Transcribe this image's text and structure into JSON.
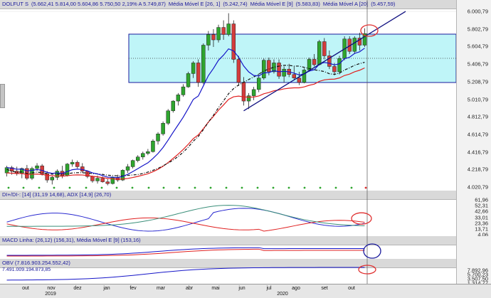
{
  "main_pane": {
    "title_parts": [
      {
        "text": "DOLFUT S",
        "color": "#1a1a9c"
      },
      {
        "text": "(5.662,41  5.814,00  5.604,86  5.750,50  2,19%  A 5.749,87)",
        "color": "#1a1a9c"
      },
      {
        "text": "Média Móvel E [26, 1]",
        "color": "#1a1a9c"
      },
      {
        "text": "(5.242,74)",
        "color": "#1a1a9c"
      },
      {
        "text": "Média Móvel E [9]",
        "color": "#1a1a9c"
      },
      {
        "text": "(5.583,83)",
        "color": "#1a1a9c"
      },
      {
        "text": "Média Móvel A [20]",
        "color": "#1a1a9c"
      },
      {
        "text": "(5.457,59)",
        "color": "#1a1a9c"
      }
    ],
    "y_labels": [
      "6.000,79",
      "5.802,79",
      "5.604,79",
      "5.406,79",
      "5.208,79",
      "5.010,79",
      "4.812,79",
      "4.614,79",
      "4.416,79",
      "4.218,79",
      "4.020,79"
    ],
    "ylim": [
      4020.79,
      6000.79
    ]
  },
  "di_pane": {
    "title": "DI+/DI-: [14] (31,19  14,68), ADX [14,9] (26,70)",
    "y_labels": [
      "61,96",
      "52,31",
      "42,66",
      "33,01",
      "23,36",
      "13,71",
      "4,06"
    ]
  },
  "macd_pane": {
    "title": "MACD Linha: (26,12) (156,31), Média Móvel E [9] (153,16)"
  },
  "obv_pane": {
    "title": "OBV (7.816.903.254.552,42)",
    "left_value": "7.491.009.194.873,85",
    "y_labels": [
      "7.892,96",
      "5.700,23",
      "3.507,50",
      "1.314,77"
    ]
  },
  "x_axis": {
    "months": [
      "out",
      "nov",
      "dez",
      "jan",
      "fev",
      "mar",
      "abr",
      "mai",
      "jun",
      "jul",
      "ago",
      "set",
      "out"
    ],
    "years": [
      "2019",
      "2020"
    ]
  },
  "colors": {
    "bull": "#2ea52e",
    "bear": "#d43c3c",
    "ema9": "#1515c8",
    "ema26": "#e02020",
    "sma20": "#111111",
    "trend": "#101080",
    "channel": "#bff5f8",
    "annotation": "#e03030",
    "di_plus": "#2a2ad0",
    "di_minus": "#e02020",
    "adx": "#3b8f7a"
  },
  "chart_data": {
    "type": "candlestick",
    "title": "DOLFUT S",
    "ylim": [
      4020.79,
      6000.79
    ],
    "ohlc": [
      [
        4180,
        4260,
        4140,
        4240
      ],
      [
        4240,
        4260,
        4160,
        4200
      ],
      [
        4200,
        4250,
        4150,
        4180
      ],
      [
        4180,
        4240,
        4120,
        4230
      ],
      [
        4230,
        4270,
        4100,
        4120
      ],
      [
        4120,
        4250,
        4100,
        4230
      ],
      [
        4230,
        4290,
        4200,
        4260
      ],
      [
        4260,
        4280,
        4150,
        4170
      ],
      [
        4170,
        4200,
        4070,
        4100
      ],
      [
        4100,
        4150,
        4050,
        4130
      ],
      [
        4130,
        4220,
        4100,
        4200
      ],
      [
        4200,
        4260,
        4120,
        4150
      ],
      [
        4150,
        4290,
        4140,
        4280
      ],
      [
        4280,
        4330,
        4250,
        4300
      ],
      [
        4300,
        4320,
        4230,
        4250
      ],
      [
        4250,
        4290,
        4180,
        4200
      ],
      [
        4200,
        4210,
        4120,
        4140
      ],
      [
        4140,
        4150,
        4070,
        4090
      ],
      [
        4090,
        4150,
        4060,
        4120
      ],
      [
        4120,
        4140,
        4070,
        4080
      ],
      [
        4080,
        4110,
        4040,
        4060
      ],
      [
        4060,
        4140,
        4050,
        4130
      ],
      [
        4130,
        4160,
        4080,
        4100
      ],
      [
        4100,
        4220,
        4090,
        4210
      ],
      [
        4210,
        4280,
        4180,
        4250
      ],
      [
        4250,
        4330,
        4230,
        4320
      ],
      [
        4320,
        4380,
        4300,
        4360
      ],
      [
        4360,
        4420,
        4330,
        4400
      ],
      [
        4400,
        4450,
        4380,
        4420
      ],
      [
        4420,
        4560,
        4410,
        4540
      ],
      [
        4540,
        4640,
        4500,
        4620
      ],
      [
        4620,
        4760,
        4600,
        4740
      ],
      [
        4740,
        4900,
        4720,
        4880
      ],
      [
        4880,
        5000,
        4860,
        4990
      ],
      [
        4990,
        5080,
        4940,
        5060
      ],
      [
        5060,
        5180,
        5040,
        5150
      ],
      [
        5150,
        5320,
        5140,
        5300
      ],
      [
        5300,
        5440,
        5250,
        5420
      ],
      [
        5420,
        5460,
        5150,
        5200
      ],
      [
        5200,
        5640,
        5180,
        5620
      ],
      [
        5620,
        5780,
        5560,
        5740
      ],
      [
        5740,
        5800,
        5600,
        5680
      ],
      [
        5680,
        5850,
        5650,
        5820
      ],
      [
        5820,
        5900,
        5680,
        5740
      ],
      [
        5740,
        5980,
        5720,
        5860
      ],
      [
        5860,
        5900,
        5420,
        5460
      ],
      [
        5460,
        5500,
        5160,
        5200
      ],
      [
        5200,
        5260,
        4940,
        4990
      ],
      [
        4990,
        5080,
        4900,
        5050
      ],
      [
        5050,
        5150,
        5000,
        5120
      ],
      [
        5120,
        5300,
        5090,
        5250
      ],
      [
        5250,
        5470,
        5230,
        5450
      ],
      [
        5450,
        5480,
        5280,
        5320
      ],
      [
        5320,
        5460,
        5300,
        5420
      ],
      [
        5420,
        5460,
        5240,
        5270
      ],
      [
        5270,
        5380,
        5200,
        5350
      ],
      [
        5350,
        5410,
        5260,
        5290
      ],
      [
        5290,
        5380,
        5230,
        5250
      ],
      [
        5250,
        5320,
        5170,
        5200
      ],
      [
        5200,
        5360,
        5190,
        5340
      ],
      [
        5340,
        5480,
        5320,
        5460
      ],
      [
        5460,
        5520,
        5380,
        5400
      ],
      [
        5400,
        5680,
        5390,
        5660
      ],
      [
        5660,
        5700,
        5460,
        5500
      ],
      [
        5500,
        5560,
        5350,
        5380
      ],
      [
        5380,
        5420,
        5280,
        5320
      ],
      [
        5320,
        5500,
        5290,
        5470
      ],
      [
        5470,
        5720,
        5450,
        5690
      ],
      [
        5690,
        5720,
        5520,
        5550
      ],
      [
        5550,
        5720,
        5520,
        5700
      ],
      [
        5700,
        5760,
        5560,
        5620
      ],
      [
        5620,
        5810,
        5600,
        5750
      ]
    ]
  }
}
